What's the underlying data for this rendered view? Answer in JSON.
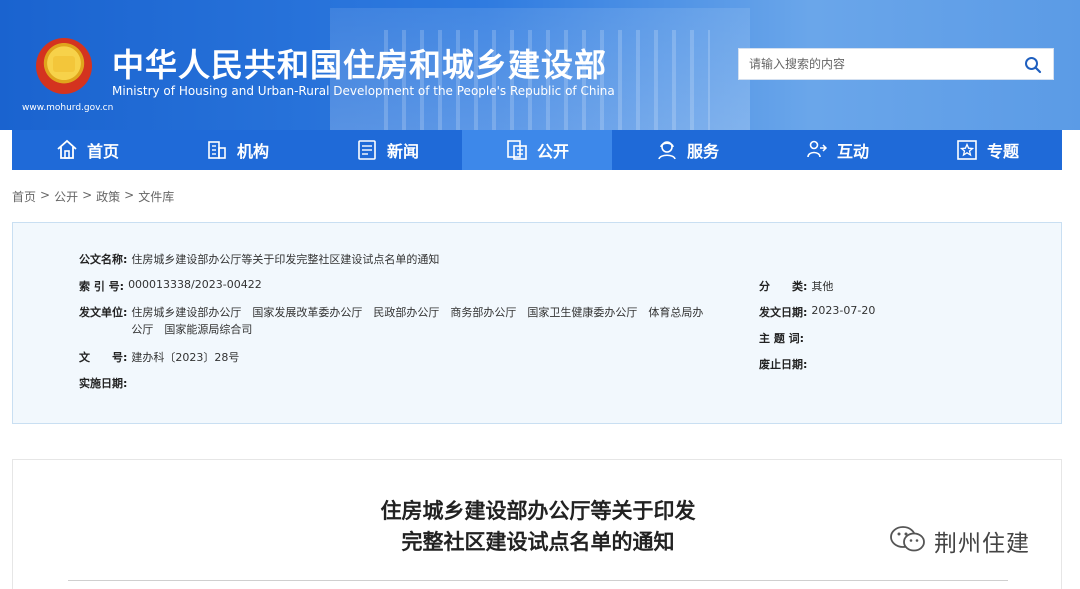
{
  "header": {
    "site_title": "中华人民共和国住房和城乡建设部",
    "site_subtitle": "Ministry of Housing and Urban-Rural Development of the People's Republic of China",
    "site_url": "www.mohurd.gov.cn"
  },
  "search": {
    "placeholder": "请输入搜索的内容",
    "icon": "search-icon"
  },
  "nav": {
    "items": [
      {
        "label": "首页",
        "icon": "home-icon"
      },
      {
        "label": "机构",
        "icon": "building-icon"
      },
      {
        "label": "新闻",
        "icon": "news-icon"
      },
      {
        "label": "公开",
        "icon": "document-icon",
        "active": true
      },
      {
        "label": "服务",
        "icon": "service-icon"
      },
      {
        "label": "互动",
        "icon": "interaction-icon"
      },
      {
        "label": "专题",
        "icon": "star-icon"
      }
    ]
  },
  "breadcrumb": [
    "首页",
    "公开",
    "政策",
    "文件库"
  ],
  "breadcrumb_sep": ">",
  "meta": {
    "title_label": "公文名称:",
    "title_value": "住房城乡建设部办公厅等关于印发完整社区建设试点名单的通知",
    "index_label": "索 引 号:",
    "index_value": "000013338/2023-00422",
    "issuer_label": "发文单位:",
    "issuer_value_line1": "住房城乡建设部办公厅　国家发展改革委办公厅　民政部办公厅　商务部办公厅　国家卫生健康委办公厅　体育总局办",
    "issuer_value_line2": "公厅　国家能源局综合司",
    "doc_no_label": "文　　号:",
    "doc_no_value": "建办科〔2023〕28号",
    "impl_date_label": "实施日期:",
    "category_label": "分　　类:",
    "category_value": "其他",
    "issue_date_label": "发文日期:",
    "issue_date_value": "2023-07-20",
    "keywords_label": "主 题 词:",
    "abolish_date_label": "废止日期:"
  },
  "article": {
    "title_line1": "住房城乡建设部办公厅等关于印发",
    "title_line2": "完整社区建设试点名单的通知"
  },
  "watermark": {
    "text": "荆州住建",
    "icon": "wechat-icon"
  }
}
